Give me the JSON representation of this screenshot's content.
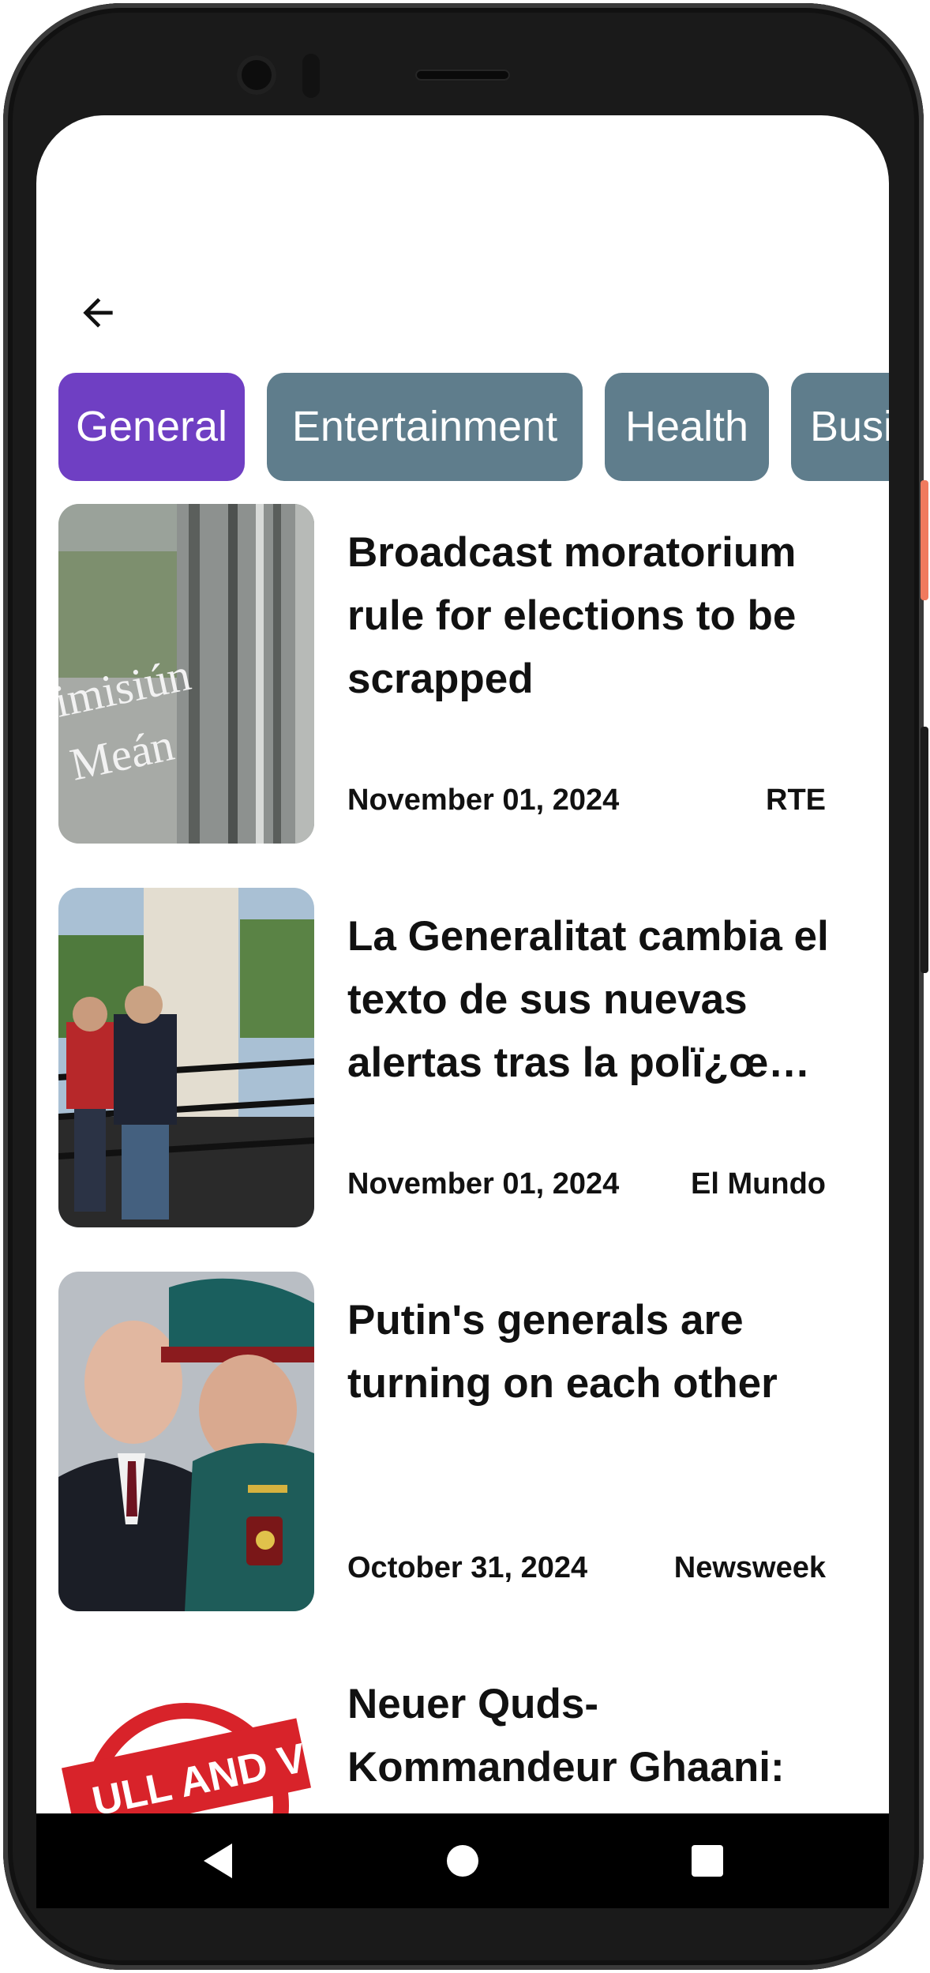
{
  "chips": [
    {
      "label": "General",
      "active": true
    },
    {
      "label": "Entertainment",
      "active": false
    },
    {
      "label": "Health",
      "active": false
    },
    {
      "label": "Business",
      "active": false
    }
  ],
  "articles": [
    {
      "title": "Broadcast moratorium rule for elections to be scrapped",
      "date": "November 01, 2024",
      "source": "RTE",
      "image": "glass-door-building-photo"
    },
    {
      "title": "La Generalitat cambia el texto de sus nuevas alertas tras la polï¿œ…",
      "date": "November 01, 2024",
      "source": "El Mundo",
      "image": "officials-on-stairs-photo"
    },
    {
      "title": "Putin's generals are turning on each other",
      "date": "October 31, 2024",
      "source": "Newsweek",
      "image": "two-leaders-talking-photo"
    },
    {
      "title": "Neuer Quds-Kommandeur Ghaani: Todesbericht - Er",
      "date": "",
      "source": "",
      "image": "null-and-void-stamp"
    }
  ],
  "colors": {
    "chip_active": "#6f3fc3",
    "chip_inactive": "#5f7d8c"
  },
  "icons": {
    "back": "arrow-back-icon",
    "nav_back": "triangle-back-icon",
    "nav_home": "circle-home-icon",
    "nav_recents": "square-recents-icon"
  }
}
